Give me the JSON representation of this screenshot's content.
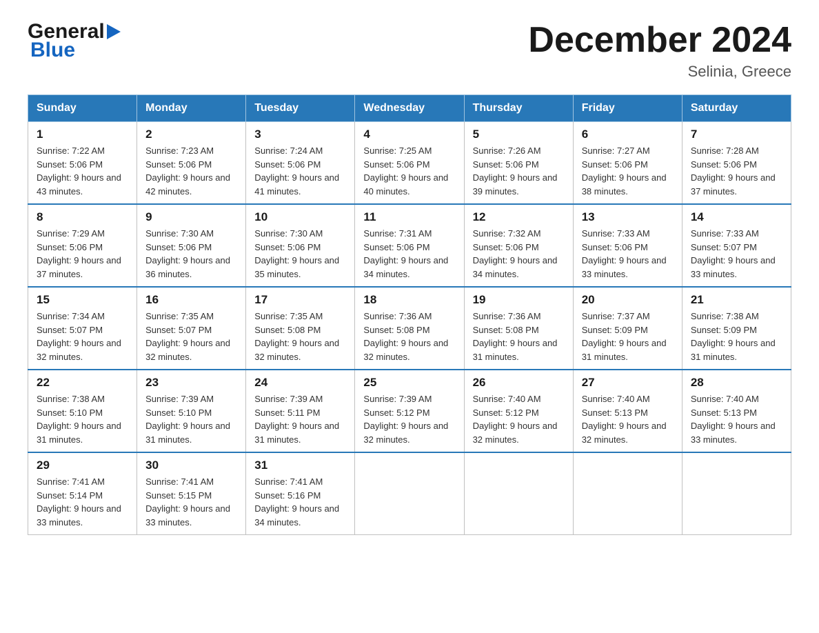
{
  "logo": {
    "line1": "General",
    "triangle": "▶",
    "line2": "Blue"
  },
  "title": "December 2024",
  "location": "Selinia, Greece",
  "days_of_week": [
    "Sunday",
    "Monday",
    "Tuesday",
    "Wednesday",
    "Thursday",
    "Friday",
    "Saturday"
  ],
  "weeks": [
    [
      {
        "day": "1",
        "sunrise": "7:22 AM",
        "sunset": "5:06 PM",
        "daylight": "9 hours and 43 minutes."
      },
      {
        "day": "2",
        "sunrise": "7:23 AM",
        "sunset": "5:06 PM",
        "daylight": "9 hours and 42 minutes."
      },
      {
        "day": "3",
        "sunrise": "7:24 AM",
        "sunset": "5:06 PM",
        "daylight": "9 hours and 41 minutes."
      },
      {
        "day": "4",
        "sunrise": "7:25 AM",
        "sunset": "5:06 PM",
        "daylight": "9 hours and 40 minutes."
      },
      {
        "day": "5",
        "sunrise": "7:26 AM",
        "sunset": "5:06 PM",
        "daylight": "9 hours and 39 minutes."
      },
      {
        "day": "6",
        "sunrise": "7:27 AM",
        "sunset": "5:06 PM",
        "daylight": "9 hours and 38 minutes."
      },
      {
        "day": "7",
        "sunrise": "7:28 AM",
        "sunset": "5:06 PM",
        "daylight": "9 hours and 37 minutes."
      }
    ],
    [
      {
        "day": "8",
        "sunrise": "7:29 AM",
        "sunset": "5:06 PM",
        "daylight": "9 hours and 37 minutes."
      },
      {
        "day": "9",
        "sunrise": "7:30 AM",
        "sunset": "5:06 PM",
        "daylight": "9 hours and 36 minutes."
      },
      {
        "day": "10",
        "sunrise": "7:30 AM",
        "sunset": "5:06 PM",
        "daylight": "9 hours and 35 minutes."
      },
      {
        "day": "11",
        "sunrise": "7:31 AM",
        "sunset": "5:06 PM",
        "daylight": "9 hours and 34 minutes."
      },
      {
        "day": "12",
        "sunrise": "7:32 AM",
        "sunset": "5:06 PM",
        "daylight": "9 hours and 34 minutes."
      },
      {
        "day": "13",
        "sunrise": "7:33 AM",
        "sunset": "5:06 PM",
        "daylight": "9 hours and 33 minutes."
      },
      {
        "day": "14",
        "sunrise": "7:33 AM",
        "sunset": "5:07 PM",
        "daylight": "9 hours and 33 minutes."
      }
    ],
    [
      {
        "day": "15",
        "sunrise": "7:34 AM",
        "sunset": "5:07 PM",
        "daylight": "9 hours and 32 minutes."
      },
      {
        "day": "16",
        "sunrise": "7:35 AM",
        "sunset": "5:07 PM",
        "daylight": "9 hours and 32 minutes."
      },
      {
        "day": "17",
        "sunrise": "7:35 AM",
        "sunset": "5:08 PM",
        "daylight": "9 hours and 32 minutes."
      },
      {
        "day": "18",
        "sunrise": "7:36 AM",
        "sunset": "5:08 PM",
        "daylight": "9 hours and 32 minutes."
      },
      {
        "day": "19",
        "sunrise": "7:36 AM",
        "sunset": "5:08 PM",
        "daylight": "9 hours and 31 minutes."
      },
      {
        "day": "20",
        "sunrise": "7:37 AM",
        "sunset": "5:09 PM",
        "daylight": "9 hours and 31 minutes."
      },
      {
        "day": "21",
        "sunrise": "7:38 AM",
        "sunset": "5:09 PM",
        "daylight": "9 hours and 31 minutes."
      }
    ],
    [
      {
        "day": "22",
        "sunrise": "7:38 AM",
        "sunset": "5:10 PM",
        "daylight": "9 hours and 31 minutes."
      },
      {
        "day": "23",
        "sunrise": "7:39 AM",
        "sunset": "5:10 PM",
        "daylight": "9 hours and 31 minutes."
      },
      {
        "day": "24",
        "sunrise": "7:39 AM",
        "sunset": "5:11 PM",
        "daylight": "9 hours and 31 minutes."
      },
      {
        "day": "25",
        "sunrise": "7:39 AM",
        "sunset": "5:12 PM",
        "daylight": "9 hours and 32 minutes."
      },
      {
        "day": "26",
        "sunrise": "7:40 AM",
        "sunset": "5:12 PM",
        "daylight": "9 hours and 32 minutes."
      },
      {
        "day": "27",
        "sunrise": "7:40 AM",
        "sunset": "5:13 PM",
        "daylight": "9 hours and 32 minutes."
      },
      {
        "day": "28",
        "sunrise": "7:40 AM",
        "sunset": "5:13 PM",
        "daylight": "9 hours and 33 minutes."
      }
    ],
    [
      {
        "day": "29",
        "sunrise": "7:41 AM",
        "sunset": "5:14 PM",
        "daylight": "9 hours and 33 minutes."
      },
      {
        "day": "30",
        "sunrise": "7:41 AM",
        "sunset": "5:15 PM",
        "daylight": "9 hours and 33 minutes."
      },
      {
        "day": "31",
        "sunrise": "7:41 AM",
        "sunset": "5:16 PM",
        "daylight": "9 hours and 34 minutes."
      },
      null,
      null,
      null,
      null
    ]
  ]
}
